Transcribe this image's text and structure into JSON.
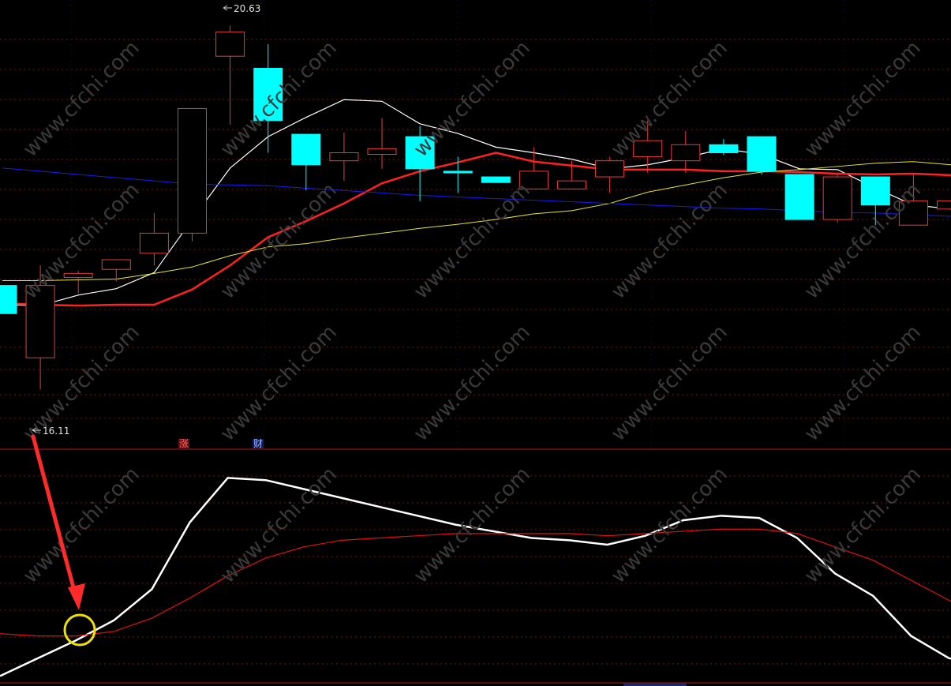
{
  "chart_data": [
    {
      "type": "candlestick",
      "panel": "price",
      "ylim": [
        15.6,
        20.9
      ],
      "grid": true,
      "price_max_label": "20.63",
      "price_min_label": "16.11",
      "colors": {
        "up": "#e83a3a",
        "down": "#00ffff",
        "background": "#000000",
        "grid": "#7a1010"
      },
      "candles": [
        {
          "o": 17.4,
          "h": 17.4,
          "l": 17.05,
          "c": 17.05
        },
        {
          "o": 16.5,
          "h": 17.65,
          "l": 16.11,
          "c": 17.4
        },
        {
          "o": 17.5,
          "h": 17.58,
          "l": 17.3,
          "c": 17.55
        },
        {
          "o": 17.6,
          "h": 17.7,
          "l": 17.45,
          "c": 17.72
        },
        {
          "o": 17.8,
          "h": 18.3,
          "l": 17.65,
          "c": 18.05
        },
        {
          "o": 18.05,
          "h": 19.6,
          "l": 17.95,
          "c": 19.6
        },
        {
          "o": 20.25,
          "h": 20.63,
          "l": 19.4,
          "c": 20.55
        },
        {
          "o": 20.1,
          "h": 20.4,
          "l": 19.05,
          "c": 19.45
        },
        {
          "o": 19.28,
          "h": 19.28,
          "l": 18.58,
          "c": 18.9
        },
        {
          "o": 18.95,
          "h": 19.3,
          "l": 18.7,
          "c": 19.05
        },
        {
          "o": 19.03,
          "h": 19.48,
          "l": 18.85,
          "c": 19.1
        },
        {
          "o": 19.25,
          "h": 19.38,
          "l": 18.45,
          "c": 18.85
        },
        {
          "o": 18.82,
          "h": 19.0,
          "l": 18.55,
          "c": 18.8
        },
        {
          "o": 18.75,
          "h": 18.75,
          "l": 18.68,
          "c": 18.68
        },
        {
          "o": 18.6,
          "h": 19.12,
          "l": 18.6,
          "c": 18.82
        },
        {
          "o": 18.6,
          "h": 18.95,
          "l": 18.6,
          "c": 18.7
        },
        {
          "o": 18.75,
          "h": 19.0,
          "l": 18.55,
          "c": 18.95
        },
        {
          "o": 19.0,
          "h": 19.45,
          "l": 18.8,
          "c": 19.2
        },
        {
          "o": 18.95,
          "h": 19.32,
          "l": 18.8,
          "c": 19.15
        },
        {
          "o": 19.15,
          "h": 19.22,
          "l": 19.02,
          "c": 19.05
        },
        {
          "o": 19.25,
          "h": 19.25,
          "l": 18.78,
          "c": 18.82
        },
        {
          "o": 18.78,
          "h": 18.78,
          "l": 18.22,
          "c": 18.22
        },
        {
          "o": 18.22,
          "h": 18.78,
          "l": 18.18,
          "c": 18.75
        },
        {
          "o": 18.75,
          "h": 18.75,
          "l": 18.15,
          "c": 18.4
        },
        {
          "o": 18.15,
          "h": 18.78,
          "l": 18.15,
          "c": 18.45
        },
        {
          "o": 18.35,
          "h": 18.6,
          "l": 18.35,
          "c": 18.45
        }
      ],
      "series": [
        {
          "color": "#ffffff",
          "values": [
            17.16,
            17.15,
            17.28,
            17.36,
            17.56,
            18.22,
            18.86,
            19.25,
            19.49,
            19.71,
            19.69,
            19.41,
            19.29,
            19.12,
            19.05,
            18.97,
            18.85,
            18.9,
            18.99,
            19.1,
            19.03,
            18.85,
            18.84,
            18.61,
            18.4,
            18.35
          ]
        },
        {
          "color": "#ff2020",
          "values": [
            17.18,
            17.16,
            17.15,
            17.16,
            17.16,
            17.35,
            17.65,
            18.0,
            18.2,
            18.42,
            18.67,
            18.82,
            18.93,
            19.05,
            18.94,
            18.89,
            18.84,
            18.84,
            18.84,
            18.82,
            18.82,
            18.81,
            18.79,
            18.78,
            18.79,
            18.77
          ]
        },
        {
          "color": "#e6e62a",
          "values": [
            17.46,
            17.46,
            17.47,
            17.48,
            17.55,
            17.63,
            17.77,
            17.88,
            17.92,
            17.99,
            18.05,
            18.11,
            18.16,
            18.22,
            18.29,
            18.33,
            18.42,
            18.56,
            18.65,
            18.74,
            18.81,
            18.84,
            18.88,
            18.92,
            18.94,
            18.9
          ]
        },
        {
          "color": "#1a1aee",
          "values": [
            18.86,
            18.82,
            18.78,
            18.74,
            18.7,
            18.66,
            18.65,
            18.64,
            18.61,
            18.58,
            18.55,
            18.52,
            18.5,
            18.48,
            18.46,
            18.44,
            18.42,
            18.4,
            18.38,
            18.36,
            18.35,
            18.33,
            18.31,
            18.3,
            18.28,
            18.26
          ]
        }
      ]
    },
    {
      "type": "line",
      "panel": "indicator",
      "ylim": [
        0,
        100
      ],
      "grid": true,
      "series": [
        {
          "color": "#ffffff",
          "values": [
            2,
            10,
            18,
            27,
            41,
            71,
            91,
            90,
            86,
            82,
            78,
            74,
            70,
            67,
            64,
            63,
            61,
            65,
            72,
            74,
            73,
            64,
            48,
            38,
            20,
            10,
            7
          ]
        },
        {
          "color": "#e01010",
          "values": [
            21,
            20,
            20,
            22,
            28,
            37,
            47,
            55,
            60,
            63,
            64,
            65,
            66,
            66,
            66,
            66,
            65,
            66,
            67,
            68,
            68,
            66,
            60,
            54,
            45,
            36,
            27
          ]
        }
      ],
      "annotation": "crossover"
    }
  ],
  "markers": {
    "m1": "涨",
    "m2": "财"
  },
  "watermark_text": "www.cfchi.com"
}
